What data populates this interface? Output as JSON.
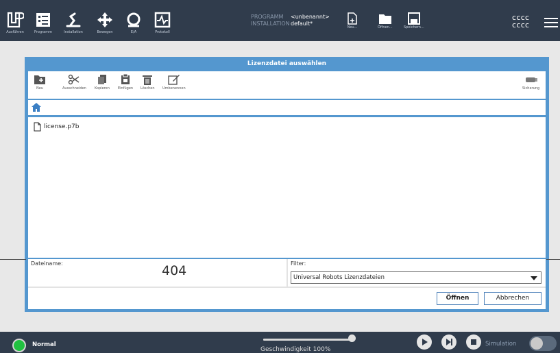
{
  "topbar": {
    "nav": [
      {
        "label": "Ausführen",
        "icon": "ur-logo-icon"
      },
      {
        "label": "Programm",
        "icon": "program-icon"
      },
      {
        "label": "Installation",
        "icon": "installation-icon"
      },
      {
        "label": "Bewegen",
        "icon": "move-icon"
      },
      {
        "label": "E/A",
        "icon": "io-icon"
      },
      {
        "label": "Protokoll",
        "icon": "log-icon"
      }
    ],
    "program_key": "PROGRAMM",
    "program_value": "<unbenannt>",
    "installation_key": "INSTALLATION",
    "installation_value": "default*",
    "file_buttons": [
      {
        "label": "Neu...",
        "icon": "new-file-icon"
      },
      {
        "label": "Öffnen...",
        "icon": "folder-icon"
      },
      {
        "label": "Speichern...",
        "icon": "save-icon"
      }
    ],
    "user_line1": "cccc",
    "user_line2": "cccc",
    "menu_icon": "hamburger-icon"
  },
  "dialog": {
    "title": "Lizenzdatei auswählen",
    "toolbar": [
      {
        "label": "Neu",
        "icon": "new-folder-icon"
      },
      {
        "label": "Ausschneiden",
        "icon": "scissors-icon"
      },
      {
        "label": "Kopieren",
        "icon": "copy-icon"
      },
      {
        "label": "Einfügen",
        "icon": "paste-icon"
      },
      {
        "label": "Löschen",
        "icon": "trash-icon"
      },
      {
        "label": "Umbenennen",
        "icon": "rename-icon"
      },
      {
        "label": "Sicherung",
        "icon": "usb-icon"
      }
    ],
    "path_icon": "home-icon",
    "files": [
      {
        "name": "license.p7b",
        "icon": "file-icon"
      }
    ],
    "filename_label": "Dateiname:",
    "filename_value": "404",
    "filter_label": "Filter:",
    "filter_value": "Universal Robots Lizenzdateien",
    "open_label": "Öffnen",
    "cancel_label": "Abbrechen"
  },
  "bottombar": {
    "status": "Normal",
    "speed_text": "Geschwindigkeit 100%",
    "speed_percent": 100,
    "controls": [
      "play-icon",
      "step-icon",
      "stop-icon"
    ],
    "simulation_label": "Simulation",
    "simulation_on": false
  },
  "colors": {
    "topbar": "#303c4c",
    "dialog_accent": "#5497cf",
    "status_ok": "#20c040"
  }
}
